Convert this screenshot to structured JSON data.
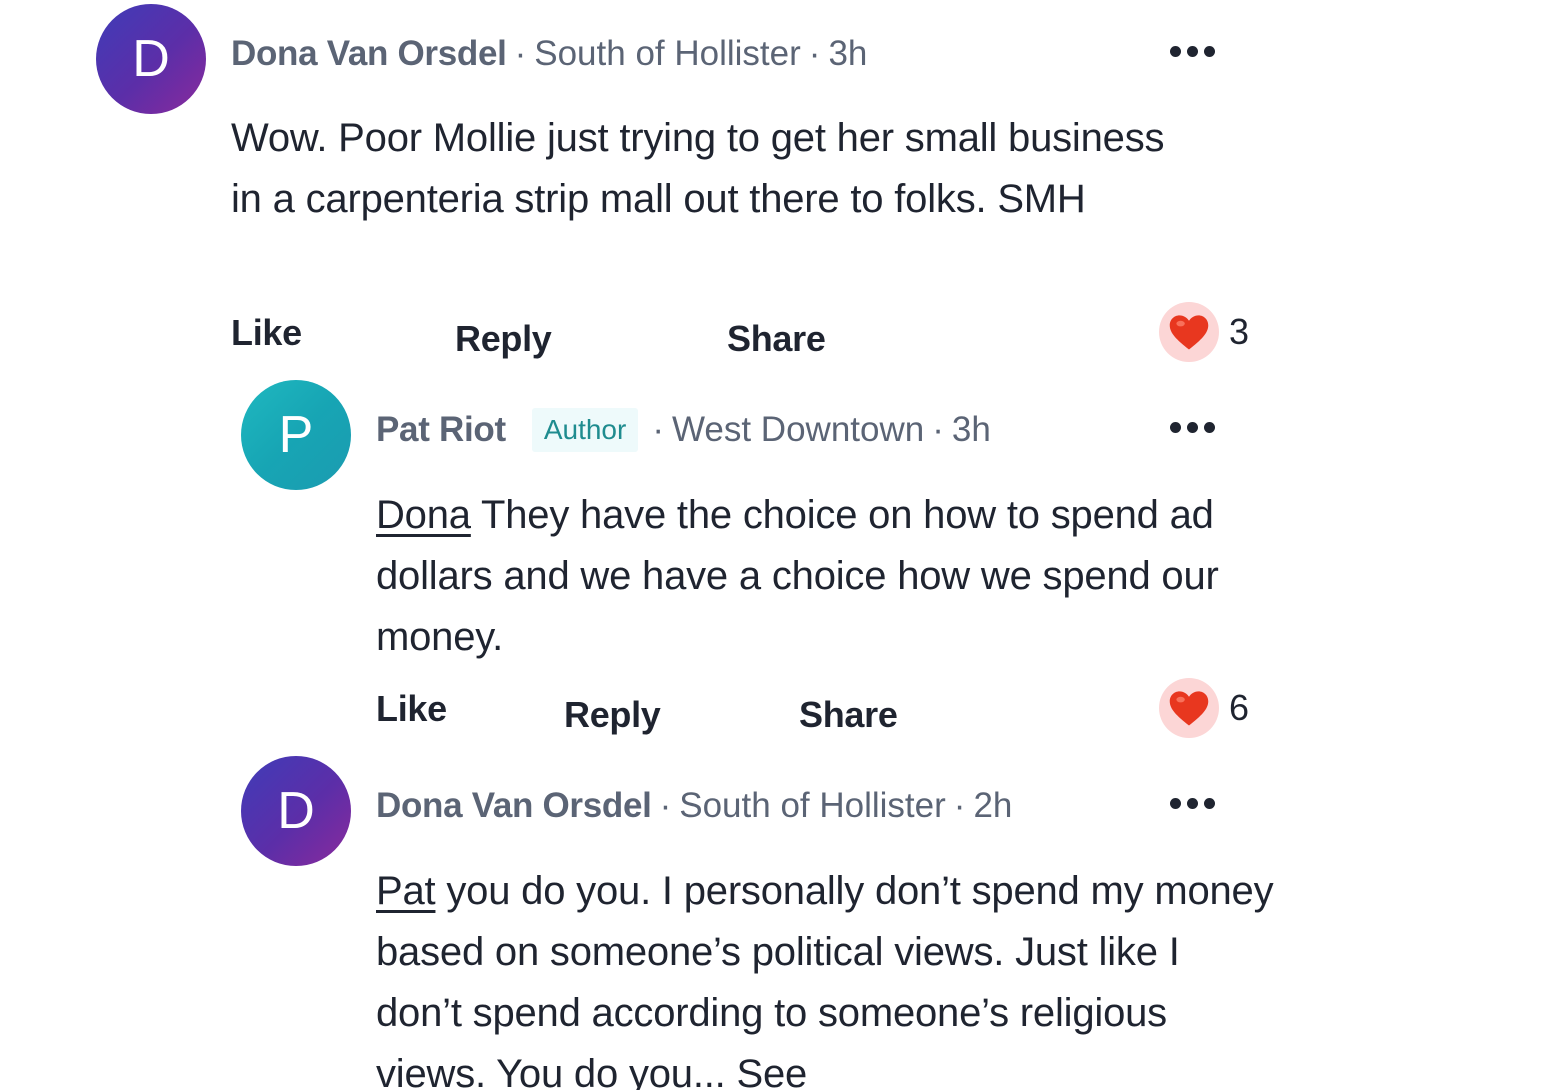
{
  "comments": [
    {
      "avatar_letter": "D",
      "author": "Dona Van Orsdel",
      "separator": "·",
      "neighborhood": "South of Hollister",
      "time": "3h",
      "text": "Wow. Poor Mollie just trying to get her small business in a carpenteria strip mall out there to folks. SMH",
      "actions": {
        "like": "Like",
        "reply": "Reply",
        "share": "Share"
      },
      "reaction_count": "3"
    },
    {
      "avatar_letter": "P",
      "author": "Pat Riot",
      "badge": "Author",
      "separator": "·",
      "neighborhood": "West Downtown",
      "time": "3h",
      "mention": "Dona",
      "text": " They have the choice on how to spend ad dollars and we have a choice how we spend our money.",
      "actions": {
        "like": "Like",
        "reply": "Reply",
        "share": "Share"
      },
      "reaction_count": "6"
    },
    {
      "avatar_letter": "D",
      "author": "Dona Van Orsdel",
      "separator": "·",
      "neighborhood": "South of Hollister",
      "time": "2h",
      "mention": "Pat",
      "text": " you do you. I personally don’t spend my money based on someone’s political views. Just like I don’t spend according to someone’s religious views. You do you...",
      "see_more": " See"
    }
  ],
  "colors": {
    "text": "#1f2430",
    "meta": "#5b6475",
    "badge_text": "#1f8c8f",
    "badge_bg": "#eefafb",
    "heart": "#e8371f",
    "reaction_bg": "#fcd6d6"
  },
  "icons": {
    "more": "more-horizontal-icon",
    "reaction": "heart-icon"
  }
}
